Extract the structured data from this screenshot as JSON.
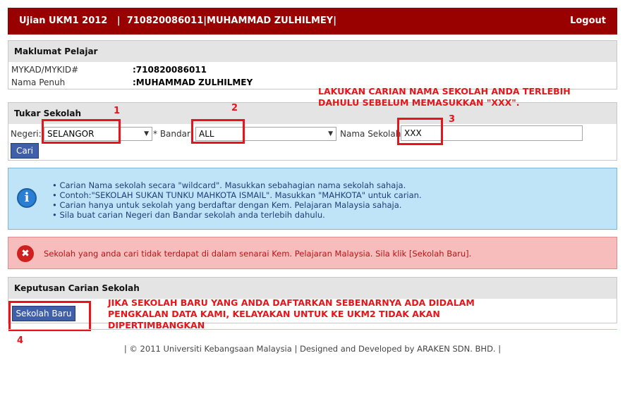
{
  "topbar": {
    "title": "Ujian UKM1 2012   |  710820086011|MUHAMMAD ZULHILMEY|",
    "logout": "Logout"
  },
  "student": {
    "heading": "Maklumat Pelajar",
    "mykad_label": "MYKAD/MYKID#",
    "mykad_value": ":710820086011",
    "name_label": "Nama Penuh",
    "name_value": ":MUHAMMAD ZULHILMEY"
  },
  "search": {
    "heading": "Tukar Sekolah",
    "negeri_label": "Negeri:",
    "negeri_value": "SELANGOR",
    "bandar_label": "* Bandar:",
    "bandar_value": "ALL",
    "school_label": "Nama Sekolah:",
    "school_value": "XXX",
    "search_button": "Cari"
  },
  "annotations": {
    "n1": "1",
    "n2": "2",
    "n3": "3",
    "n4": "4",
    "note_top_line1": "LAKUKAN CARIAN NAMA SEKOLAH ANDA TERLEBIH",
    "note_top_line2": "DAHULU SEBELUM MEMASUKKAN \"XXX\".",
    "note_bottom_line1": "JIKA SEKOLAH BARU YANG ANDA DAFTARKAN SEBENARNYA ADA DIDALAM",
    "note_bottom_line2": "PENGKALAN DATA KAMI, KELAYAKAN UNTUK KE UKM2 TIDAK AKAN",
    "note_bottom_line3": "DIPERTIMBANGKAN"
  },
  "info": {
    "items": [
      "Carian Nama sekolah secara \"wildcard\". Masukkan sebahagian nama sekolah sahaja.",
      "Contoh:\"SEKOLAH SUKAN TUNKU MAHKOTA ISMAIL\". Masukkan \"MAHKOTA\" untuk carian.",
      "Carian hanya untuk sekolah yang berdaftar dengan Kem. Pelajaran Malaysia sahaja.",
      "Sila buat carian Negeri dan Bandar sekolah anda terlebih dahulu."
    ]
  },
  "error": {
    "message": "Sekolah yang anda cari tidak terdapat di dalam senarai Kem. Pelajaran Malaysia. Sila klik [Sekolah Baru]."
  },
  "results": {
    "heading": "Keputusan Carian Sekolah",
    "new_school_button": "Sekolah Baru"
  },
  "footer": {
    "text": "| © 2011 Universiti Kebangsaan Malaysia | Designed and Developed by ARAKEN SDN. BHD. |"
  },
  "colors": {
    "topbar": "#990000",
    "annotation_red": "#e8141a",
    "button_blue": "#3f5fa8",
    "info_bg": "#bfe3f7",
    "error_bg": "#f7bcbc"
  }
}
